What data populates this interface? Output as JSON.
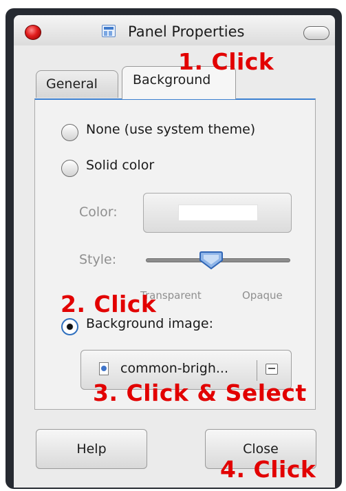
{
  "window": {
    "title": "Panel Properties",
    "tabs": [
      {
        "label": "General",
        "active": false
      },
      {
        "label": "Background",
        "active": true
      }
    ]
  },
  "background": {
    "none_option": "None (use system theme)",
    "solid_option": "Solid color",
    "color_label": "Color:",
    "style_label": "Style:",
    "slider_min_label": "Transparent",
    "slider_max_label": "Opaque",
    "slider_value_fraction": 0.45,
    "image_option": "Background image:",
    "image_file": "common-brigh...",
    "selected": "image"
  },
  "buttons": {
    "help": "Help",
    "close": "Close"
  },
  "annotations": {
    "step1": "1. Click",
    "step2": "2. Click",
    "step3": "3. Click & Select",
    "step4": "4. Click"
  },
  "colors": {
    "annotation": "#e20000",
    "accent": "#3a7fd0",
    "frame": "#262a31"
  }
}
